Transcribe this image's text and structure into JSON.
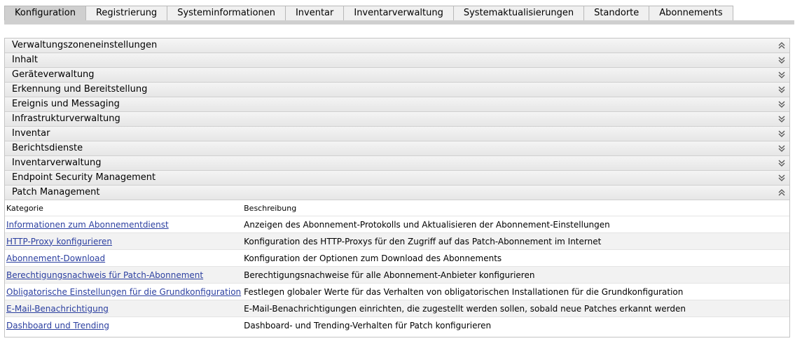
{
  "tabs": [
    {
      "label": "Konfiguration",
      "active": true
    },
    {
      "label": "Registrierung",
      "active": false
    },
    {
      "label": "Systeminformationen",
      "active": false
    },
    {
      "label": "Inventar",
      "active": false
    },
    {
      "label": "Inventarverwaltung",
      "active": false
    },
    {
      "label": "Systemaktualisierungen",
      "active": false
    },
    {
      "label": "Standorte",
      "active": false
    },
    {
      "label": "Abonnements",
      "active": false
    }
  ],
  "panel": {
    "title": "Verwaltungszoneneinstellungen",
    "title_state": "expanded",
    "sections": [
      {
        "label": "Inhalt",
        "state": "collapsed"
      },
      {
        "label": "Geräteverwaltung",
        "state": "collapsed"
      },
      {
        "label": "Erkennung und Bereitstellung",
        "state": "collapsed"
      },
      {
        "label": "Ereignis und Messaging",
        "state": "collapsed"
      },
      {
        "label": "Infrastrukturverwaltung",
        "state": "collapsed"
      },
      {
        "label": "Inventar",
        "state": "collapsed"
      },
      {
        "label": "Berichtsdienste",
        "state": "collapsed"
      },
      {
        "label": "Inventarverwaltung",
        "state": "collapsed"
      },
      {
        "label": "Endpoint Security Management",
        "state": "collapsed"
      },
      {
        "label": "Patch Management",
        "state": "expanded"
      }
    ]
  },
  "patch_table": {
    "headers": {
      "category": "Kategorie",
      "description": "Beschreibung"
    },
    "rows": [
      {
        "category": "Informationen zum Abonnementdienst",
        "description": "Anzeigen des Abonnement-Protokolls und Aktualisieren der Abonnement-Einstellungen"
      },
      {
        "category": "HTTP-Proxy konfigurieren",
        "description": "Konfiguration des HTTP-Proxys für den Zugriff auf das Patch-Abonnement im Internet"
      },
      {
        "category": "Abonnement-Download",
        "description": "Konfiguration der Optionen zum Download des Abonnements"
      },
      {
        "category": "Berechtigungsnachweis für Patch-Abonnement",
        "description": "Berechtigungsnachweise für alle Abonnement-Anbieter konfigurieren"
      },
      {
        "category": "Obligatorische Einstellungen für die Grundkonfiguration",
        "description": "Festlegen globaler Werte für das Verhalten von obligatorischen Installationen für die Grundkonfiguration"
      },
      {
        "category": "E-Mail-Benachrichtigung",
        "description": "E-Mail-Benachrichtigungen einrichten, die zugestellt werden sollen, sobald neue Patches erkannt werden"
      },
      {
        "category": "Dashboard und Trending",
        "description": "Dashboard- und Trending-Verhalten für Patch konfigurieren"
      }
    ]
  },
  "colors": {
    "link": "#2b3fa0",
    "active_tab": "#cfcfcf",
    "header_bg": "#eeeeee"
  }
}
